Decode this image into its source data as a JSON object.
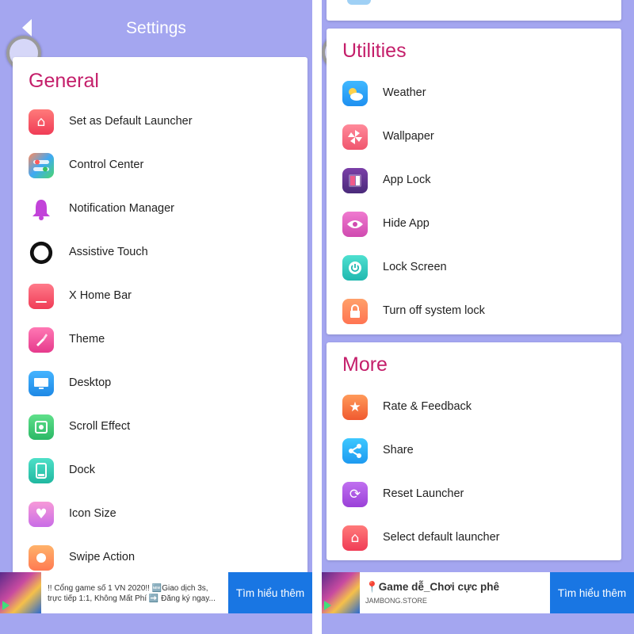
{
  "left": {
    "header": {
      "title": "Settings"
    },
    "general_section": {
      "title": "General",
      "items": [
        {
          "label": "Set as Default Launcher",
          "icon": "home-icon"
        },
        {
          "label": "Control Center",
          "icon": "control-center-icon"
        },
        {
          "label": "Notification Manager",
          "icon": "bell-icon"
        },
        {
          "label": "Assistive Touch",
          "icon": "assistive-touch-icon"
        },
        {
          "label": "X Home Bar",
          "icon": "home-bar-icon"
        },
        {
          "label": "Theme",
          "icon": "paintbrush-icon"
        },
        {
          "label": "Desktop",
          "icon": "monitor-icon"
        },
        {
          "label": "Scroll Effect",
          "icon": "scroll-effect-icon"
        },
        {
          "label": "Dock",
          "icon": "dock-icon"
        },
        {
          "label": "Icon Size",
          "icon": "heart-icon"
        },
        {
          "label": "Swipe Action",
          "icon": "swipe-icon"
        }
      ]
    },
    "ad": {
      "text": "!! Cổng game số 1 VN 2020!! 🆕Giao dịch 3s, trực tiếp 1:1, Không Mất Phí ➡️ Đăng ký ngay...",
      "button": "Tìm hiểu thêm"
    }
  },
  "right": {
    "utilities_section": {
      "title": "Utilities",
      "items": [
        {
          "label": "Weather",
          "icon": "weather-icon"
        },
        {
          "label": "Wallpaper",
          "icon": "pinwheel-icon"
        },
        {
          "label": "App Lock",
          "icon": "lock-icon"
        },
        {
          "label": "Hide App",
          "icon": "eye-icon"
        },
        {
          "label": "Lock Screen",
          "icon": "power-icon"
        },
        {
          "label": "Turn off system lock",
          "icon": "padlock-icon"
        }
      ]
    },
    "more_section": {
      "title": "More",
      "items": [
        {
          "label": "Rate & Feedback",
          "icon": "star-icon"
        },
        {
          "label": "Share",
          "icon": "share-icon"
        },
        {
          "label": "Reset Launcher",
          "icon": "refresh-icon"
        },
        {
          "label": "Select default launcher",
          "icon": "home-icon"
        }
      ]
    },
    "ad": {
      "title": "📍Game dễ_Chơi cực phê",
      "sub": "JAMBONG.STORE",
      "button": "Tìm hiểu thêm"
    }
  },
  "colors": {
    "background": "#a4a6f0",
    "section_title": "#c41e6a",
    "ad_button": "#1976e3"
  }
}
